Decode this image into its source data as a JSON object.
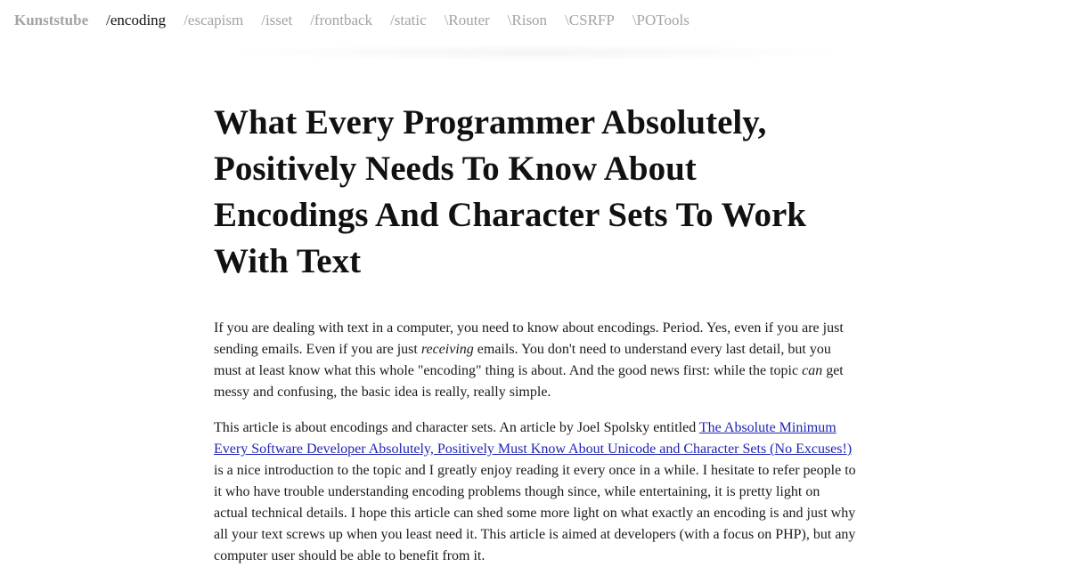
{
  "site": {
    "brand": "Kunststube",
    "nav": [
      {
        "label": "/encoding",
        "active": true
      },
      {
        "label": "/escapism",
        "active": false
      },
      {
        "label": "/isset",
        "active": false
      },
      {
        "label": "/frontback",
        "active": false
      },
      {
        "label": "/static",
        "active": false
      },
      {
        "label": "\\Router",
        "active": false
      },
      {
        "label": "\\Rison",
        "active": false
      },
      {
        "label": "\\CSRFP",
        "active": false
      },
      {
        "label": "\\POTools",
        "active": false
      }
    ]
  },
  "article": {
    "title": "What Every Programmer Absolutely, Positively Needs To Know About Encodings And Character Sets To Work With Text",
    "p1": {
      "t1": "If you are dealing with text in a computer, you need to know about encodings. Period. Yes, even if you are just sending emails. Even if you are just ",
      "em1": "receiving",
      "t2": " emails. You don't need to understand every last detail, but you must at least know what this whole \"encoding\" thing is about. And the good news first: while the topic ",
      "em2": "can",
      "t3": " get messy and confusing, the basic idea is really, really simple."
    },
    "p2": {
      "t1": "This article is about encodings and character sets. An article by Joel Spolsky entitled ",
      "link": "The Absolute Minimum Every Software Developer Absolutely, Positively Must Know About Unicode and Character Sets (No Excuses!)",
      "t2": " is a nice introduction to the topic and I greatly enjoy reading it every once in a while. I hesitate to refer people to it who have trouble understanding encoding problems though since, while entertaining, it is pretty light on actual technical details. I hope this article can shed some more light on what exactly an encoding is and just why all your text screws up when you least need it. This article is aimed at developers (with a focus on PHP), but any computer user should be able to benefit from it."
    }
  },
  "colors": {
    "nav_inactive": "#a3a3a3",
    "nav_active": "#111111",
    "link": "#1f25b5"
  }
}
